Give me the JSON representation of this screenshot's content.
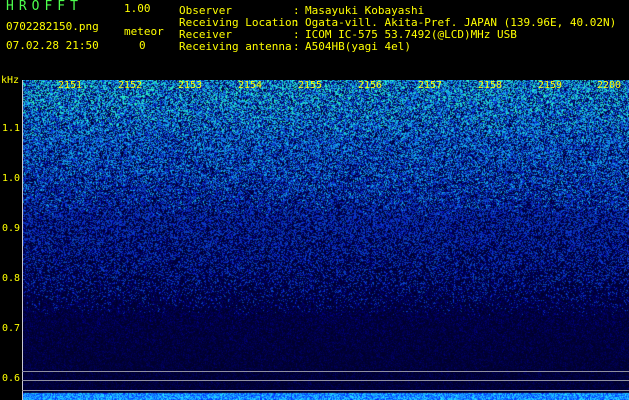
{
  "header": {
    "app_name": "HROFFT",
    "version": "1.00",
    "filename": "0702282150.png",
    "datetime": "07.02.28 21:50",
    "meteor_label": "meteor",
    "meteor_count": "0"
  },
  "info": {
    "rows": [
      {
        "label": "Observer",
        "value": "Masayuki Kobayashi"
      },
      {
        "label": "Receiving Location",
        "value": "Ogata-vill. Akita-Pref. JAPAN (139.96E, 40.02N)"
      },
      {
        "label": "Receiver",
        "value": "ICOM IC-575 53.7492(@LCD)MHz USB"
      },
      {
        "label": "Receiving antenna",
        "value": "A504HB(yagi 4el)"
      }
    ]
  },
  "spectrogram": {
    "y_unit": "kHz",
    "y_ticks": [
      "1.1",
      "1.0",
      "0.9",
      "0.8",
      "0.7",
      "0.6"
    ],
    "y_values": [
      1.1,
      1.0,
      0.9,
      0.8,
      0.7,
      0.6
    ],
    "x_ticks": [
      "2151",
      "2152",
      "2153",
      "2154",
      "2155",
      "2156",
      "2157",
      "2158",
      "2159",
      "2200"
    ],
    "colors": {
      "background": "#000020",
      "noise_low": "#1030c0",
      "noise_high": "#30ff60",
      "text": "#ffff00"
    }
  }
}
